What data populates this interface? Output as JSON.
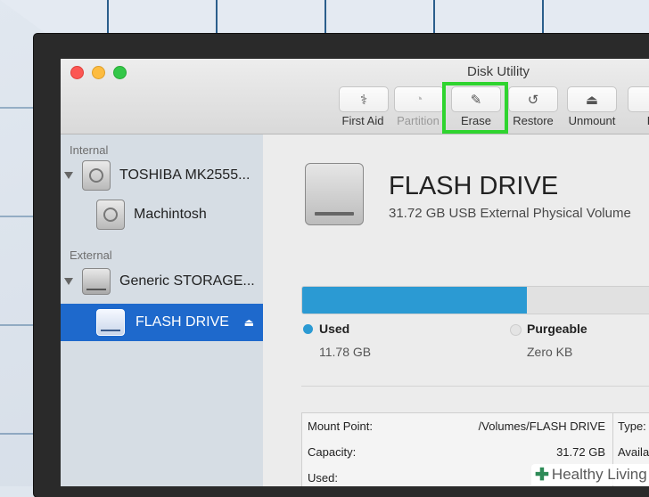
{
  "window": {
    "title": "Disk Utility"
  },
  "toolbar": {
    "buttons": [
      {
        "label": "First Aid",
        "icon": "stethoscope-icon",
        "enabled": true,
        "glyph": "⚕"
      },
      {
        "label": "Partition",
        "icon": "partition-icon",
        "enabled": false,
        "glyph": "◔"
      },
      {
        "label": "Erase",
        "icon": "erase-icon",
        "enabled": true,
        "glyph": "✎"
      },
      {
        "label": "Restore",
        "icon": "restore-icon",
        "enabled": true,
        "glyph": "↺"
      },
      {
        "label": "Unmount",
        "icon": "unmount-icon",
        "enabled": true,
        "glyph": "⏏"
      },
      {
        "label": "In",
        "icon": "info-icon",
        "enabled": true,
        "glyph": "i"
      }
    ],
    "highlight_color": "#2fd42f"
  },
  "sidebar": {
    "internal_header": "Internal",
    "external_header": "External",
    "items": [
      {
        "label": "TOSHIBA MK2555..."
      },
      {
        "label": "Machintosh"
      },
      {
        "label": "Generic STORAGE..."
      },
      {
        "label": "FLASH DRIVE",
        "selected": true
      }
    ],
    "selection_color": "#1e69cc"
  },
  "main": {
    "drive_name": "FLASH DRIVE",
    "drive_description": "31.72 GB USB External Physical Volume",
    "usage": {
      "used_fraction": 0.6,
      "bar_color": "#2b9ad3"
    },
    "legend": {
      "used_label": "Used",
      "used_value": "11.78 GB",
      "purgeable_label": "Purgeable",
      "purgeable_value": "Zero KB"
    },
    "info": {
      "mount_point_label": "Mount Point:",
      "mount_point_value": "/Volumes/FLASH DRIVE",
      "capacity_label": "Capacity:",
      "capacity_value": "31.72 GB",
      "used_label": "Used:",
      "type_label": "Type:",
      "available_label": "Availal"
    }
  },
  "watermark": {
    "text": "Healthy Living"
  }
}
